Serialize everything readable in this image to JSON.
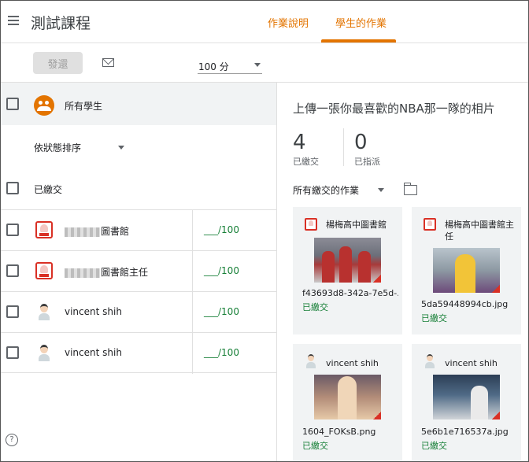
{
  "course_title": "測試課程",
  "tabs": [
    "作業說明",
    "學生的作業"
  ],
  "toolbar": {
    "return_label": "發還",
    "points": "100 分"
  },
  "left": {
    "all_students": "所有學生",
    "sort": "依狀態排序",
    "section_turned_in": "已繳交",
    "students": [
      {
        "name_suffix": "圖書館",
        "blurred": true,
        "avatar": "school",
        "grade": "___/100"
      },
      {
        "name_suffix": "圖書館主任",
        "blurred": true,
        "avatar": "school",
        "grade": "___/100"
      },
      {
        "name_suffix": "vincent shih",
        "blurred": false,
        "avatar": "person",
        "grade": "___/100"
      },
      {
        "name_suffix": "vincent shih",
        "blurred": false,
        "avatar": "person",
        "grade": "___/100"
      }
    ],
    "help": "?"
  },
  "right": {
    "assignment_title": "上傳一張你最喜歡的NBA那一隊的相片",
    "turned_in_count": "4",
    "turned_in_label": "已繳交",
    "assigned_count": "0",
    "assigned_label": "已指派",
    "filter": "所有繳交的作業",
    "cards": [
      {
        "student": "楊梅高中圖書館",
        "file": "f43693d8-342a-7e5d-...",
        "status": "已繳交"
      },
      {
        "student": "楊梅高中圖書館主任",
        "file": "5da59448994cb.jpg",
        "status": "已繳交"
      },
      {
        "student": "vincent shih",
        "file": "1604_FOKsB.png",
        "status": "已繳交"
      },
      {
        "student": "vincent shih",
        "file": "5e6b1e716537a.jpg",
        "status": "已繳交"
      }
    ]
  },
  "colors": {
    "accent": "#e37400",
    "turned_in": "#188038",
    "school_avatar": "#d93025"
  }
}
